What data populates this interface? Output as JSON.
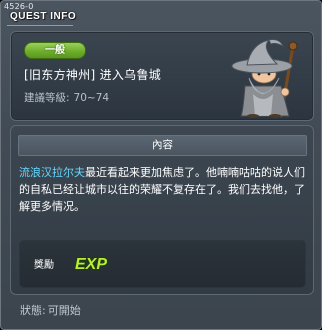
{
  "window": {
    "id_label": "4526-0",
    "title": "QUEST INFO"
  },
  "header": {
    "badge": "一般",
    "quest_name": "[旧东方神州] 进入乌鲁城",
    "level_label": "建議等級:",
    "level_range": "70~74"
  },
  "content": {
    "section_title": "內容",
    "npc_name": "流浪汉拉尔夫",
    "description": "最近看起来更加焦虑了。他喃喃咕咕的说人们的自私已经让城市以往的荣耀不复存在了。我们去找他，了解更多情况。"
  },
  "reward": {
    "label": "獎勵",
    "exp_text": "EXP"
  },
  "status": {
    "label": "狀態:",
    "value": "可開始"
  },
  "colors": {
    "npc_name": "#67d8ff",
    "badge_green": "#6fae2c",
    "exp_text": "#b6ef34"
  },
  "icons": {
    "npc": "old-wizard-npc-portrait",
    "exp": "exp-reward-icon"
  }
}
